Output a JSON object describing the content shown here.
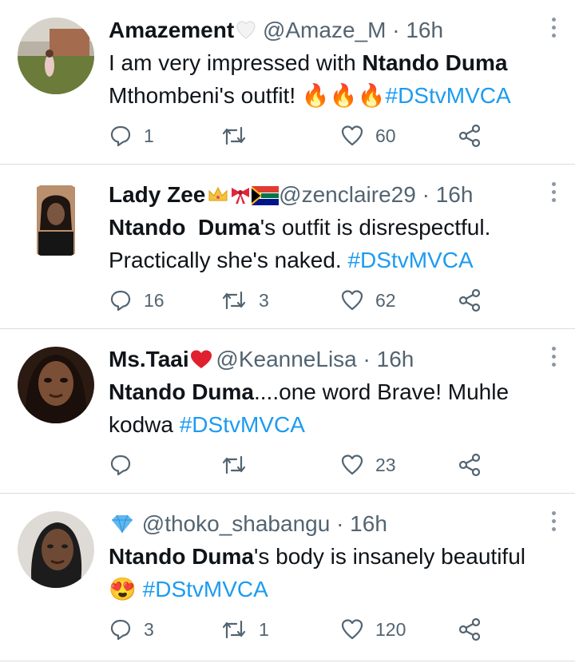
{
  "tweets": [
    {
      "name": "Amazement",
      "name_emoji": "white-heart",
      "handle": "@Amaze_M",
      "separator": "·",
      "time": "16h",
      "text_parts": [
        {
          "t": "I am very impressed with ",
          "style": "plain"
        },
        {
          "t": "Ntando Duma",
          "style": "bold"
        },
        {
          "t": " Mthombeni's outfit! ",
          "style": "plain"
        },
        {
          "t": "🔥🔥🔥",
          "style": "emoji"
        },
        {
          "t": "#DStvMVCA",
          "style": "hashtag"
        }
      ],
      "replies": "1",
      "retweets": "",
      "likes": "60"
    },
    {
      "name": "Lady Zee",
      "name_emoji": "crown-ribbon-za-flag",
      "handle": "@zenclaire29",
      "separator": "·",
      "time": "16h",
      "text_parts": [
        {
          "t": "Ntando  Duma",
          "style": "bold"
        },
        {
          "t": "'s outfit is disrespectful. Practically she's naked. ",
          "style": "plain"
        },
        {
          "t": "#DStvMVCA",
          "style": "hashtag"
        }
      ],
      "replies": "16",
      "retweets": "3",
      "likes": "62"
    },
    {
      "name": "Ms.Taai",
      "name_emoji": "red-heart",
      "handle": "@KeanneLisa",
      "separator": "·",
      "time": "16h",
      "text_parts": [
        {
          "t": "Ntando Duma",
          "style": "bold"
        },
        {
          "t": "....one word Brave! Muhle kodwa ",
          "style": "plain"
        },
        {
          "t": "#DStvMVCA",
          "style": "hashtag"
        }
      ],
      "replies": "",
      "retweets": "",
      "likes": "23"
    },
    {
      "name": "",
      "name_emoji": "diamond",
      "handle": "@thoko_shabangu",
      "separator": "·",
      "time": "16h",
      "text_parts": [
        {
          "t": "Ntando Duma",
          "style": "bold"
        },
        {
          "t": "'s body is insanely beautiful ",
          "style": "plain"
        },
        {
          "t": "😍",
          "style": "emoji"
        },
        {
          "t": " ",
          "style": "plain"
        },
        {
          "t": "#DStvMVCA",
          "style": "hashtag"
        }
      ],
      "replies": "3",
      "retweets": "1",
      "likes": "120"
    }
  ],
  "icons": {
    "reply": "reply-icon",
    "retweet": "retweet-icon",
    "like": "heart-icon",
    "share": "share-icon",
    "more": "more-options-icon"
  },
  "colors": {
    "hashtag": "#1d9bf0",
    "muted": "#536471",
    "text": "#0f1419",
    "divider": "#d9dee2"
  }
}
